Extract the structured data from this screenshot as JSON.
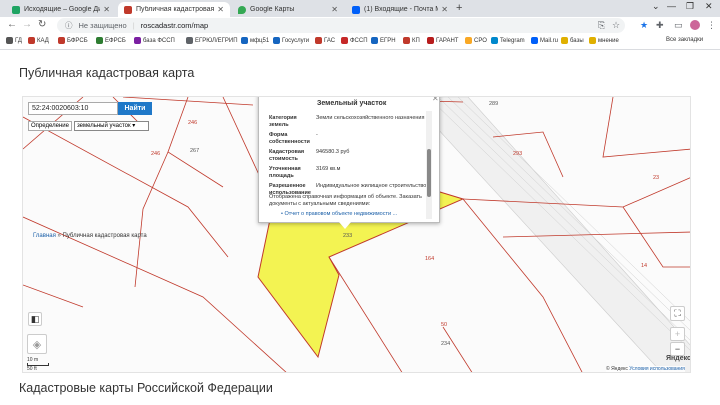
{
  "browser": {
    "tabs": [
      {
        "label": "Исходящие – Google Диск",
        "active": false,
        "color": "#1fa463"
      },
      {
        "label": "Публичная кадастровая карта",
        "active": true,
        "color": "#c0392b"
      },
      {
        "label": "Google Карты",
        "active": false,
        "color": "#34a853"
      },
      {
        "label": "(1) Входящие - Почта Mail.ru",
        "active": false,
        "color": "#005ff9"
      }
    ],
    "security_label": "Не защищено",
    "url": "roscadastr.com/map",
    "bookmarks": [
      "ГД",
      "КАД",
      "БФРСБ",
      "ЕФРСБ",
      "база ФССП",
      "ЕГРЮЛ/ЕГРИП",
      "мфц51",
      "Госуслуги",
      "ГАС",
      "ФССП",
      "ЕГРН",
      "КП",
      "ГАРАНТ",
      "СРО",
      "Telegram",
      "Mail.ru",
      "базы",
      "мнение"
    ],
    "all_bookmarks": "Все закладки"
  },
  "page": {
    "title": "Публичная кадастровая карта",
    "section_title": "Кадастровые карты Российской Федерации"
  },
  "map": {
    "search_value": "52:24:0020603:10",
    "search_button": "Найти",
    "definition_label": "Определение",
    "definition_select": "земельный участок",
    "breadcrumb_home": "Главная",
    "breadcrumb_sep": "»",
    "breadcrumb_current": "Публичная кадастровая карта",
    "popup": {
      "title": "Земельный участок",
      "category_key": "Категория земель",
      "category_value": "Земли сельскохозяйственного назначения",
      "ownership_key": "Форма собственности",
      "ownership_value": "-",
      "cost_key": "Кадастровая стоимость",
      "cost_value": "946580.3 руб",
      "area_key": "Уточненная площадь",
      "area_value": "3169 кв.м",
      "use_key": "Разрешенное использование",
      "use_value": "Индивидуальное жилищное строительство",
      "note": "Отображена справочная информация об объекте. Заказать документы с актуальными сведениями:",
      "link": "Отчет о правовом объекте недвижимости ..."
    },
    "plot_numbers": [
      "289",
      "267",
      "246",
      "246",
      "233",
      "293",
      "23",
      "14",
      "234",
      "164",
      "50"
    ],
    "scale_top": "10 m",
    "scale_bottom": "50 ft",
    "logo": "Яндекс",
    "copyright": "© Яндекс",
    "terms": "Условия использования",
    "highlight_color": "#f3f352",
    "boundary_color": "#c0392b"
  }
}
